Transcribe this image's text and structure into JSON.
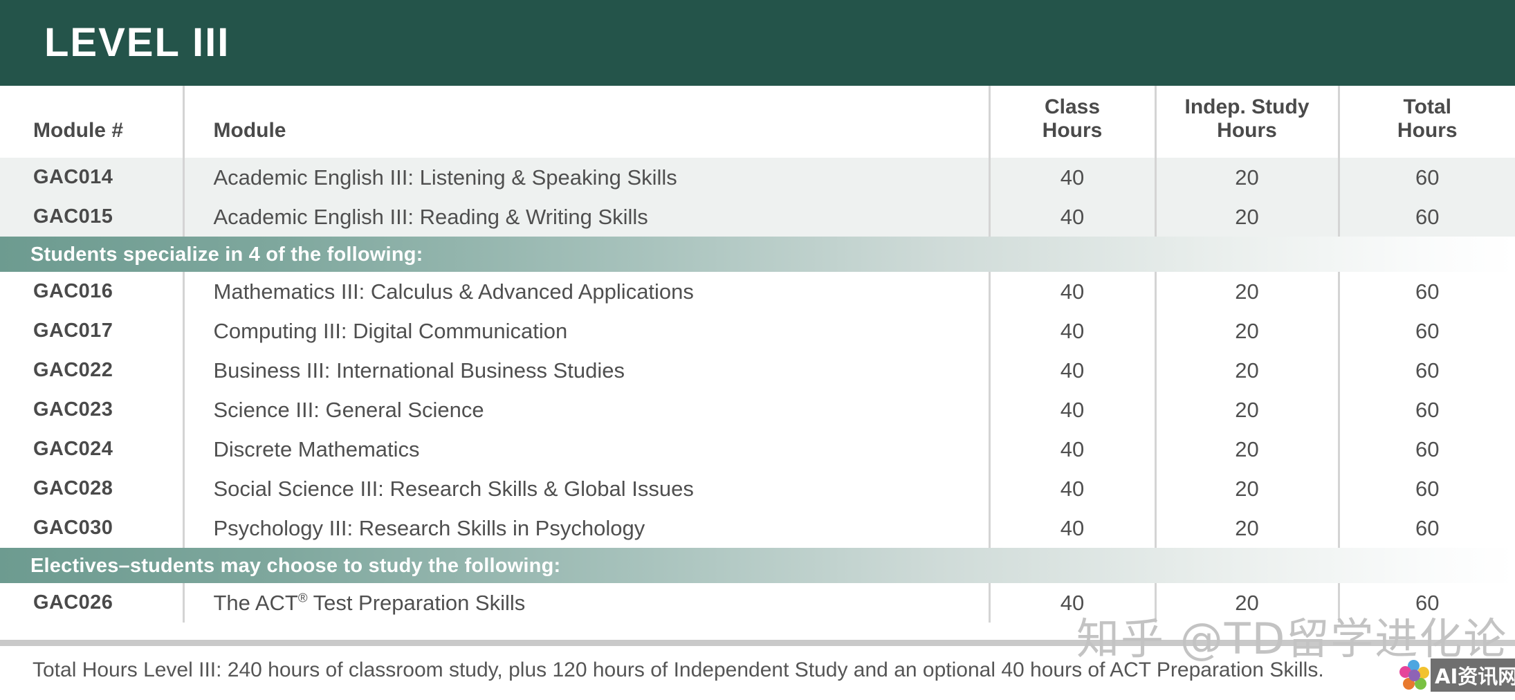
{
  "banner": {
    "title": "LEVEL III",
    "background_color": "#24544a",
    "text_color": "#ffffff"
  },
  "table": {
    "headers": {
      "module_number": "Module #",
      "module": "Module",
      "class_hours_line1": "Class",
      "class_hours_line2": "Hours",
      "indep_study_line1": "Indep. Study",
      "indep_study_line2": "Hours",
      "total_hours_line1": "Total",
      "total_hours_line2": "Hours"
    },
    "core_rows": [
      {
        "module_number": "GAC014",
        "module": "Academic English III: Listening & Speaking Skills",
        "class_hours": "40",
        "indep_study_hours": "20",
        "total_hours": "60"
      },
      {
        "module_number": "GAC015",
        "module": "Academic English III: Reading & Writing Skills",
        "class_hours": "40",
        "indep_study_hours": "20",
        "total_hours": "60"
      }
    ],
    "specialize_section_label": "Students specialize in 4 of the following:",
    "specialize_rows": [
      {
        "module_number": "GAC016",
        "module": "Mathematics III: Calculus & Advanced Applications",
        "class_hours": "40",
        "indep_study_hours": "20",
        "total_hours": "60"
      },
      {
        "module_number": "GAC017",
        "module": "Computing III: Digital Communication",
        "class_hours": "40",
        "indep_study_hours": "20",
        "total_hours": "60"
      },
      {
        "module_number": "GAC022",
        "module": "Business III: International Business Studies",
        "class_hours": "40",
        "indep_study_hours": "20",
        "total_hours": "60"
      },
      {
        "module_number": "GAC023",
        "module": "Science III: General Science",
        "class_hours": "40",
        "indep_study_hours": "20",
        "total_hours": "60"
      },
      {
        "module_number": "GAC024",
        "module": "Discrete Mathematics",
        "class_hours": "40",
        "indep_study_hours": "20",
        "total_hours": "60"
      },
      {
        "module_number": "GAC028",
        "module": "Social Science III: Research Skills & Global Issues",
        "class_hours": "40",
        "indep_study_hours": "20",
        "total_hours": "60"
      },
      {
        "module_number": "GAC030",
        "module": "Psychology III: Research Skills in Psychology",
        "class_hours": "40",
        "indep_study_hours": "20",
        "total_hours": "60"
      }
    ],
    "electives_section_label": "Electives–students may choose to study the following:",
    "elective_rows": [
      {
        "module_number": "GAC026",
        "module_prefix": "The ACT",
        "module_superscript": "®",
        "module_suffix": " Test Preparation Skills",
        "class_hours": "40",
        "indep_study_hours": "20",
        "total_hours": "60"
      }
    ]
  },
  "footer": {
    "note": "Total Hours Level III: 240 hours of classroom study, plus 120 hours of Independent Study and an optional 40 hours of ACT Preparation Skills."
  },
  "watermarks": {
    "zhihu": "知乎 @TD留学进化论",
    "badge_text": "AI资讯网"
  }
}
